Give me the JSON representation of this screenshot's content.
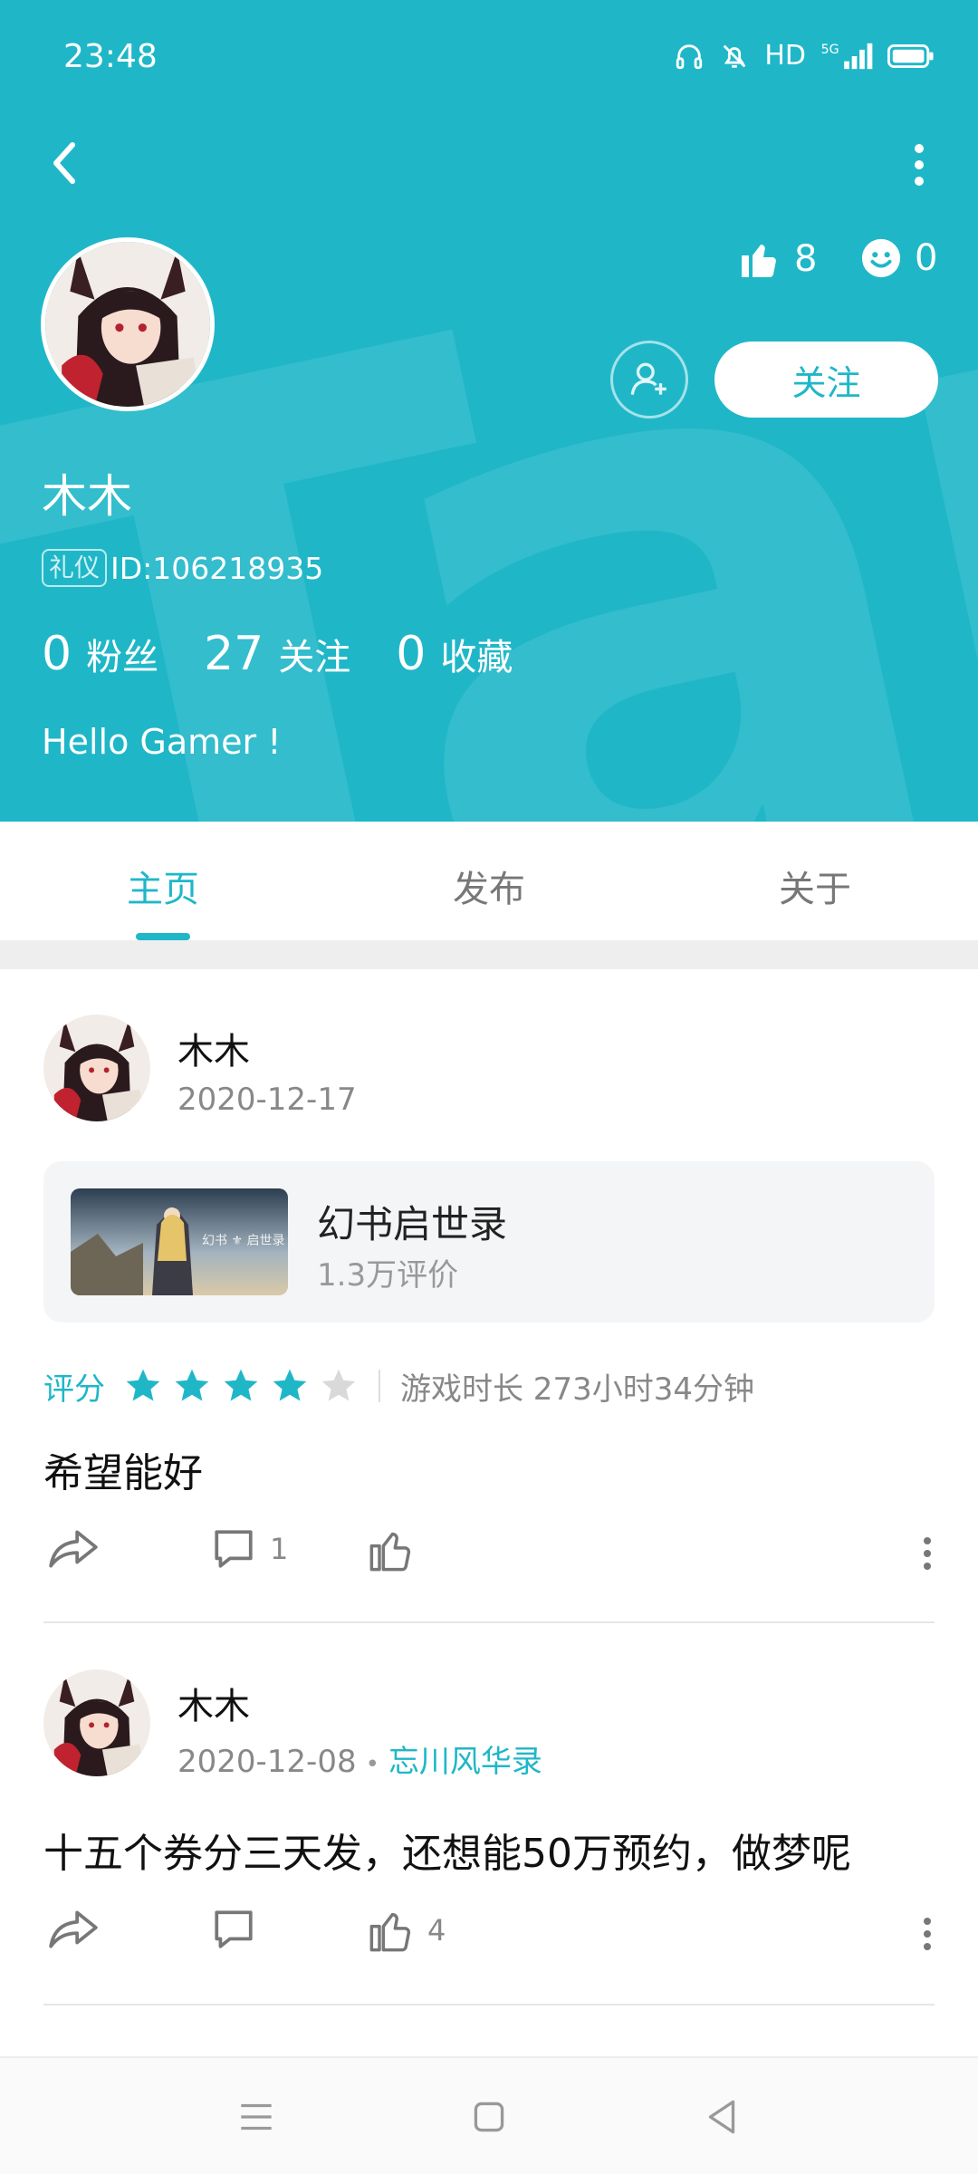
{
  "status_bar": {
    "time": "23:48",
    "network": "HD",
    "signal": "5G"
  },
  "header": {
    "likes": "8",
    "smiles": "0",
    "follow_label": "关注",
    "user_name": "木木",
    "badge": "礼仪",
    "user_id": "ID:106218935",
    "counts": [
      {
        "num": "0",
        "label": "粉丝"
      },
      {
        "num": "27",
        "label": "关注"
      },
      {
        "num": "0",
        "label": "收藏"
      }
    ],
    "bio": "Hello Gamer !",
    "watermark": "TapTap"
  },
  "tabs": [
    {
      "label": "主页",
      "active": true
    },
    {
      "label": "发布",
      "active": false
    },
    {
      "label": "关于",
      "active": false
    }
  ],
  "posts": [
    {
      "author": "木木",
      "date": "2020-12-17",
      "game": {
        "title": "幻书启世录",
        "reviews": "1.3万评价"
      },
      "rating_label": "评分",
      "rating": 4,
      "rating_max": 5,
      "play_time": "游戏时长 273小时34分钟",
      "text": "希望能好",
      "comments": "1",
      "likes": ""
    },
    {
      "author": "木木",
      "date": "2020-12-08",
      "dot": "•",
      "topic": "忘川风华录",
      "text": "十五个券分三天发，还想能50万预约，做梦呢",
      "comments": "",
      "likes": "4"
    }
  ],
  "colors": {
    "accent": "#1fb7c8",
    "star_inactive": "#d9d9d9"
  },
  "icons": [
    "back-icon",
    "more-icon",
    "thumbs-up-icon",
    "smile-icon",
    "add-friend-icon",
    "star-icon",
    "share-icon",
    "comment-icon",
    "like-icon",
    "nav-menu-icon",
    "nav-home-icon",
    "nav-back-icon"
  ]
}
